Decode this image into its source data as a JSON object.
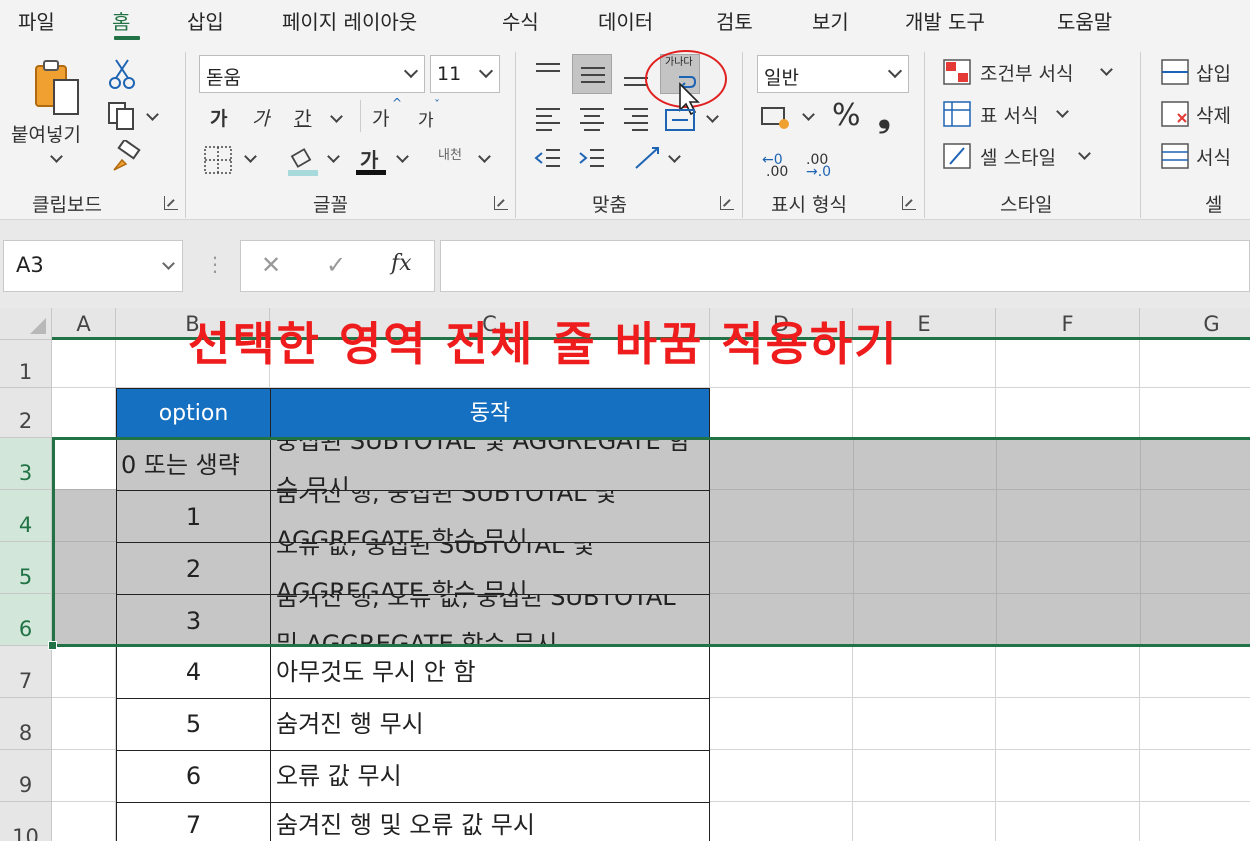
{
  "menu": {
    "tabs": [
      "파일",
      "홈",
      "삽입",
      "페이지 레이아웃",
      "수식",
      "데이터",
      "검토",
      "보기",
      "개발 도구",
      "도움말"
    ],
    "active": "홈"
  },
  "ribbon": {
    "clipboard": {
      "paste_label": "붙여넣기",
      "group_label": "클립보드"
    },
    "font": {
      "name": "돋움",
      "size": "11",
      "bold": "가",
      "italic": "가",
      "underline": "간",
      "grow": "가",
      "shrink": "가",
      "font_color_glyph": "가",
      "phonetic": "내천",
      "group_label": "글꼴"
    },
    "alignment": {
      "wrap_icon_text": "가나다",
      "group_label": "맞춤"
    },
    "number": {
      "format": "일반",
      "percent": "%",
      "comma": "❟",
      "inc_decimal": ".00",
      "dec_decimal": ".00",
      "group_label": "표시 형식"
    },
    "styles": {
      "conditional": "조건부 서식",
      "table": "표 서식",
      "cell_style": "셀 스타일",
      "group_label": "스타일"
    },
    "cells": {
      "insert": "삽입",
      "delete": "삭제",
      "format": "서식",
      "group_label": "셀"
    }
  },
  "formula_bar": {
    "name_box": "A3",
    "cancel": "✕",
    "enter": "✓",
    "fx": "fx",
    "formula": ""
  },
  "grid": {
    "columns": [
      "A",
      "B",
      "C",
      "D",
      "E",
      "F",
      "G"
    ],
    "rows": [
      "1",
      "2",
      "3",
      "4",
      "5",
      "6",
      "7",
      "8",
      "9",
      "10"
    ],
    "selected_rows": [
      "3",
      "4",
      "5",
      "6"
    ]
  },
  "table": {
    "header": [
      "option",
      "동작"
    ],
    "rows": [
      [
        "0 또는 생략",
        "중첩된 SUBTOTAL 및 AGGREGATE 함수 무시"
      ],
      [
        "1",
        "숨겨진 행, 중첩된 SUBTOTAL 및 AGGREGATE 함수 무시"
      ],
      [
        "2",
        "오류 값, 중첩된 SUBTOTAL 및 AGGREGATE 함수 무시"
      ],
      [
        "3",
        "숨겨진 행, 오류 값, 중첩된 SUBTOTAL 및 AGGREGATE 함수 무시"
      ],
      [
        "4",
        "아무것도 무시 안 함"
      ],
      [
        "5",
        "숨겨진 행 무시"
      ],
      [
        "6",
        "오류 값 무시"
      ],
      [
        "7",
        "숨겨진 행 및 오류 값 무시"
      ]
    ]
  },
  "annotation": "선택한 영역 전체 줄 바꿈 적용하기",
  "colors": {
    "accent": "#217346",
    "table_header": "#1570c2",
    "banner": "#ee1c1c",
    "selection_fill": "#c6c6c6"
  }
}
